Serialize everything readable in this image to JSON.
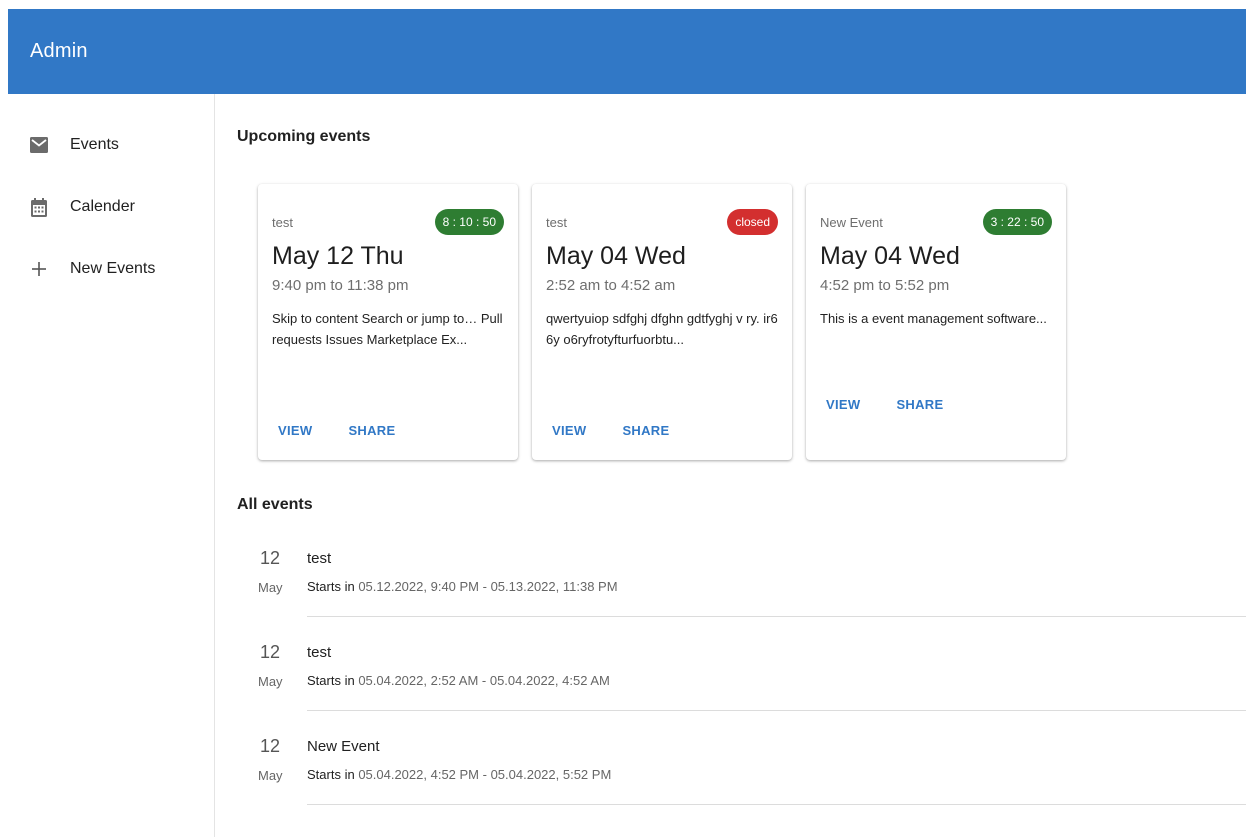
{
  "appbar": {
    "title": "Admin",
    "color": "#3178c6"
  },
  "sidebar": {
    "items": [
      {
        "label": "Events",
        "icon": "mail-icon"
      },
      {
        "label": "Calender",
        "icon": "calendar-icon"
      },
      {
        "label": "New Events",
        "icon": "plus-icon"
      }
    ]
  },
  "upcoming": {
    "title": "Upcoming events",
    "cards": [
      {
        "name": "test",
        "badge": "8 : 10 : 50",
        "badge_status": "green",
        "date": "May 12 Thu",
        "time": "9:40 pm to 11:38 pm",
        "description": "Skip to content Search or jump to… Pull requests Issues Marketplace Ex...",
        "view_label": "VIEW",
        "share_label": "SHARE"
      },
      {
        "name": "test",
        "badge": "closed",
        "badge_status": "red",
        "date": "May 04 Wed",
        "time": "2:52 am to 4:52 am",
        "description": "qwertyuiop sdfghj dfghn gdtfyghj v ry. ir6 6y o6ryfrotyfturfuorbtu...",
        "view_label": "VIEW",
        "share_label": "SHARE"
      },
      {
        "name": "New Event",
        "badge": "3 : 22 : 50",
        "badge_status": "green",
        "date": "May 04 Wed",
        "time": "4:52 pm to 5:52 pm",
        "description": "This is a event management software...",
        "view_label": "VIEW",
        "share_label": "SHARE"
      }
    ]
  },
  "all_events": {
    "title": "All events",
    "items": [
      {
        "day": "12",
        "month": "May",
        "title": "test",
        "starts_label": "Starts in",
        "range": "05.12.2022, 9:40 PM - 05.13.2022, 11:38 PM"
      },
      {
        "day": "12",
        "month": "May",
        "title": "test",
        "starts_label": "Starts in",
        "range": "05.04.2022, 2:52 AM - 05.04.2022, 4:52 AM"
      },
      {
        "day": "12",
        "month": "May",
        "title": "New Event",
        "starts_label": "Starts in",
        "range": "05.04.2022, 4:52 PM - 05.04.2022, 5:52 PM"
      }
    ]
  },
  "colors": {
    "accent": "#3178c6",
    "badge_green": "#2e7d32",
    "badge_red": "#d32f2f"
  }
}
